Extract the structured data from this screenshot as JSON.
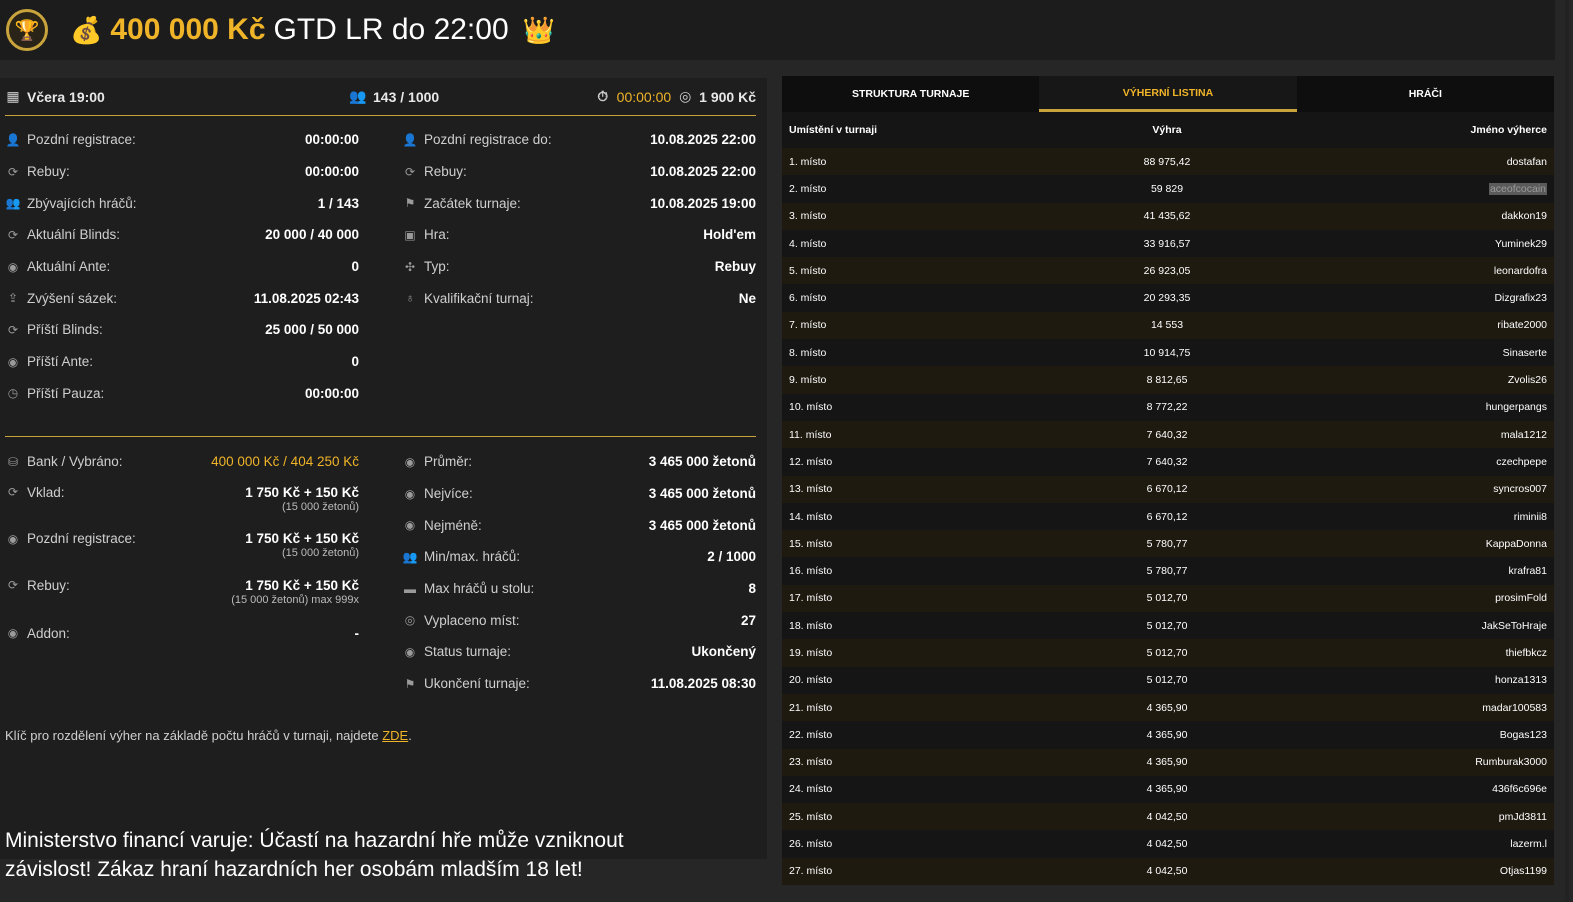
{
  "header": {
    "logo_icon": "trophy-icon",
    "bag_icon": "money-bag-icon",
    "amount": "400 000 Kč",
    "name": "GTD LR do 22:00",
    "crown_icon": "crown-icon"
  },
  "summary": {
    "date": "Včera 19:00",
    "players": "143 / 1000",
    "timer": "00:00:00",
    "fee": "1 900 Kč"
  },
  "info_left": [
    {
      "label": "Pozdní registrace:",
      "value": "00:00:00"
    },
    {
      "label": "Rebuy:",
      "value": "00:00:00"
    },
    {
      "label": "Zbývajících hráčů:",
      "value": "1 / 143"
    },
    {
      "label": "Aktuální Blinds:",
      "value": "20 000 / 40 000"
    },
    {
      "label": "Aktuální Ante:",
      "value": "0"
    },
    {
      "label": "Zvýšení sázek:",
      "value": "11.08.2025 02:43"
    },
    {
      "label": "Příští Blinds:",
      "value": "25 000 / 50 000"
    },
    {
      "label": "Příští Ante:",
      "value": "0"
    },
    {
      "label": "Příští Pauza:",
      "value": "00:00:00"
    }
  ],
  "info_right": [
    {
      "label": "Pozdní registrace do:",
      "value": "10.08.2025 22:00"
    },
    {
      "label": "Rebuy:",
      "value": "10.08.2025 22:00"
    },
    {
      "label": "Začátek turnaje:",
      "value": "10.08.2025 19:00"
    },
    {
      "label": "Hra:",
      "value": "Hold'em"
    },
    {
      "label": "Typ:",
      "value": "Rebuy"
    },
    {
      "label": "Kvalifikační turnaj:",
      "value": "Ne"
    }
  ],
  "money_left": [
    {
      "label": "Bank / Vybráno:",
      "value": "400 000 Kč / 404 250 Kč",
      "sub": ""
    },
    {
      "label": "Vklad:",
      "value": "1 750 Kč + 150 Kč",
      "sub": "(15 000 žetonů)"
    },
    {
      "label": "Pozdní registrace:",
      "value": "1 750 Kč + 150 Kč",
      "sub": "(15 000 žetonů)"
    },
    {
      "label": "Rebuy:",
      "value": "1 750 Kč + 150 Kč",
      "sub": "(15 000 žetonů) max 999x"
    },
    {
      "label": "Addon:",
      "value": "-",
      "sub": ""
    }
  ],
  "money_right": [
    {
      "label": "Průměr:",
      "value": "3 465 000 žetonů"
    },
    {
      "label": "Nejvíce:",
      "value": "3 465 000 žetonů"
    },
    {
      "label": "Nejméně:",
      "value": "3 465 000 žetonů"
    },
    {
      "label": "Min/max. hráčů:",
      "value": "2 / 1000"
    },
    {
      "label": "Max hráčů u stolu:",
      "value": "8"
    },
    {
      "label": "Vyplaceno míst:",
      "value": "27"
    },
    {
      "label": "Status turnaje:",
      "value": "Ukončený"
    },
    {
      "label": "Ukončení turnaje:",
      "value": "11.08.2025 08:30"
    }
  ],
  "note": {
    "text": "Klíč pro rozdělení výher na základě počtu hráčů v turnaji, najdete ",
    "link": "ZDE",
    "end": "."
  },
  "warning": "Ministerstvo financí varuje: Účastí na hazardní hře může vzniknout závislost! Zákaz hraní hazardních her osobám mladším 18 let!",
  "tabs": [
    "STRUKTURA TURNAJE",
    "VÝHERNÍ LISTINA",
    "HRÁČI"
  ],
  "table": {
    "headers": [
      "Umístění v turnaji",
      "Výhra",
      "Jméno výherce"
    ],
    "rows": [
      [
        "1. místo",
        "88 975,42",
        "dostafan"
      ],
      [
        "2. místo",
        "59 829",
        "aceofcocain"
      ],
      [
        "3. místo",
        "41 435,62",
        "dakkon19"
      ],
      [
        "4. místo",
        "33 916,57",
        "Yuminek29"
      ],
      [
        "5. místo",
        "26 923,05",
        "leonardofra"
      ],
      [
        "6. místo",
        "20 293,35",
        "Dizgrafix23"
      ],
      [
        "7. místo",
        "14 553",
        "ribate2000"
      ],
      [
        "8. místo",
        "10 914,75",
        "Sinaserte"
      ],
      [
        "9. místo",
        "8 812,65",
        "Zvolis26"
      ],
      [
        "10. místo",
        "8 772,22",
        "hungerpangs"
      ],
      [
        "11. místo",
        "7 640,32",
        "mala1212"
      ],
      [
        "12. místo",
        "7 640,32",
        "czechpepe"
      ],
      [
        "13. místo",
        "6 670,12",
        "syncros007"
      ],
      [
        "14. místo",
        "6 670,12",
        "riminii8"
      ],
      [
        "15. místo",
        "5 780,77",
        "KappaDonna"
      ],
      [
        "16. místo",
        "5 780,77",
        "krafra81"
      ],
      [
        "17. místo",
        "5 012,70",
        "prosimFold"
      ],
      [
        "18. místo",
        "5 012,70",
        "JakSeToHraje"
      ],
      [
        "19. místo",
        "5 012,70",
        "thiefbkcz"
      ],
      [
        "20. místo",
        "5 012,70",
        "honza1313"
      ],
      [
        "21. místo",
        "4 365,90",
        "madar100583"
      ],
      [
        "22. místo",
        "4 365,90",
        "Bogas123"
      ],
      [
        "23. místo",
        "4 365,90",
        "Rumburak3000"
      ],
      [
        "24. místo",
        "4 365,90",
        "436f6c696e"
      ],
      [
        "25. místo",
        "4 042,50",
        "pmJd3811"
      ],
      [
        "26. místo",
        "4 042,50",
        "lazerm.l"
      ],
      [
        "27. místo",
        "4 042,50",
        "Otjas1199"
      ]
    ]
  }
}
